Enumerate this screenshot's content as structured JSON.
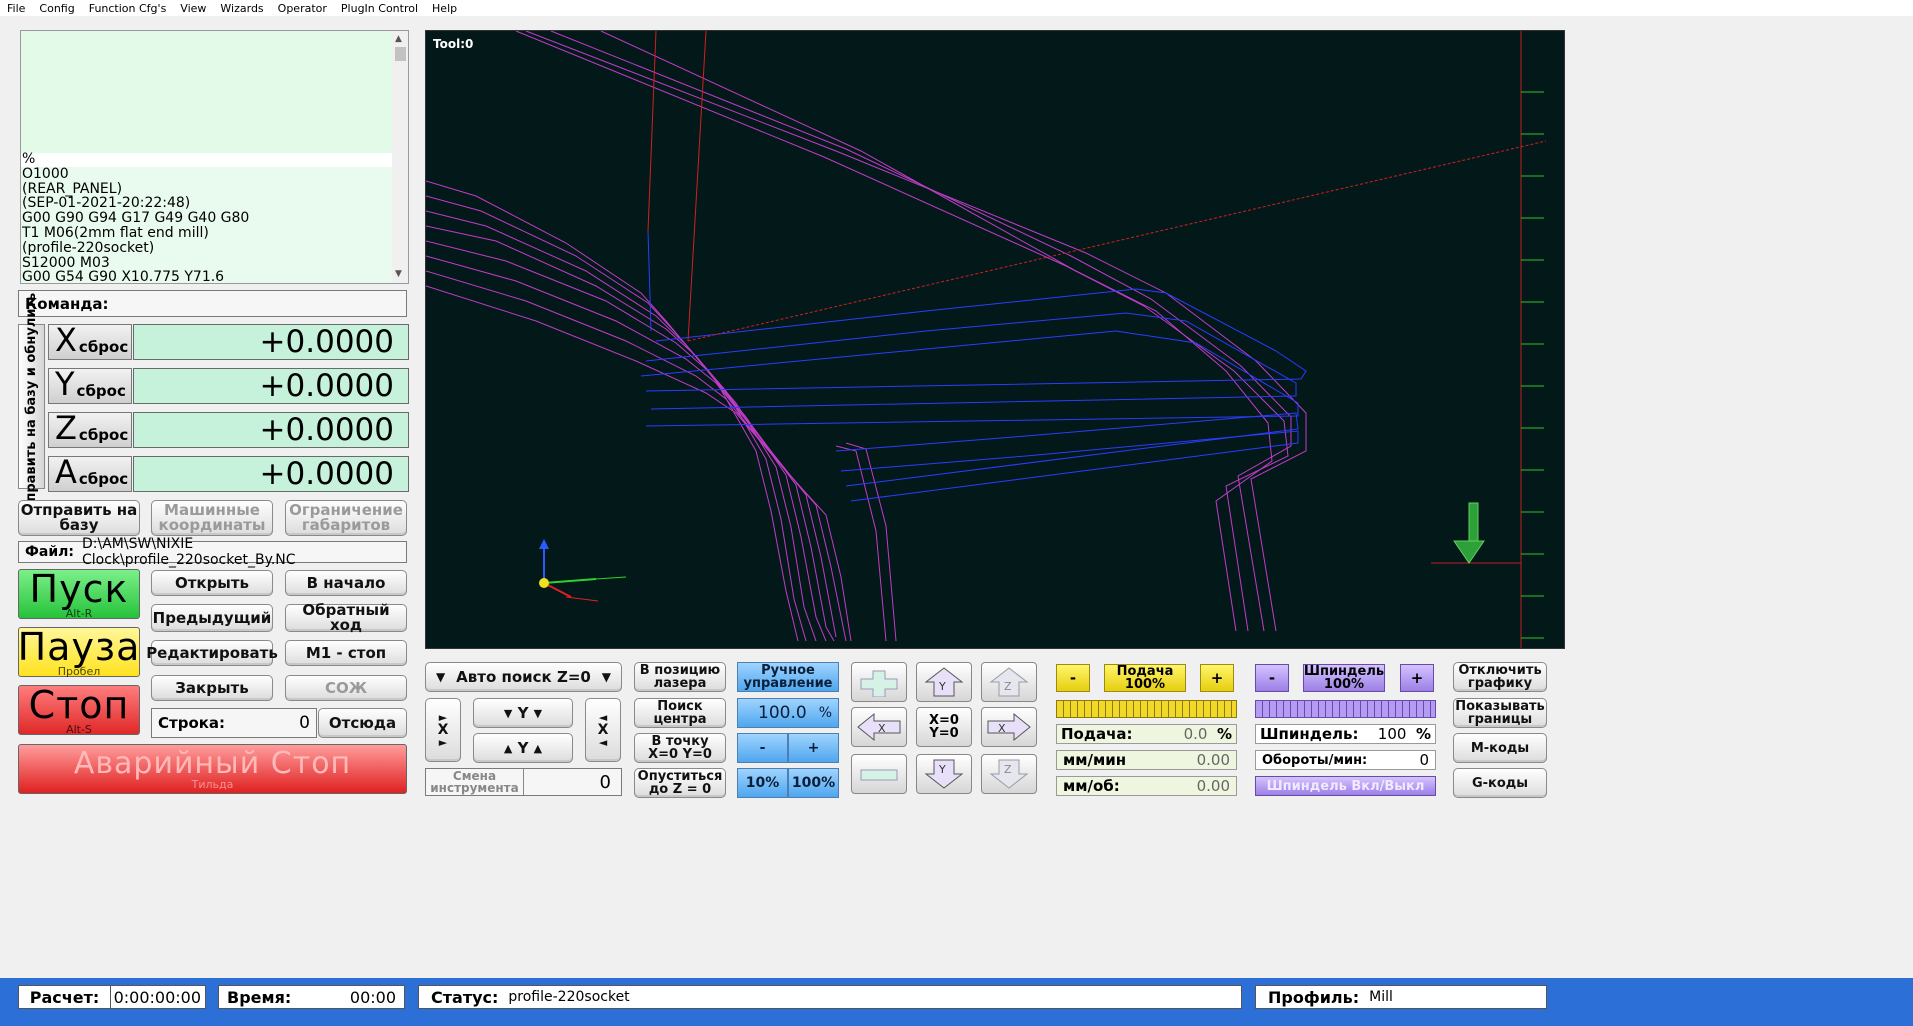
{
  "menu": [
    "File",
    "Config",
    "Function Cfg's",
    "View",
    "Wizards",
    "Operator",
    "PlugIn Control",
    "Help"
  ],
  "gcode_lines": [
    "%",
    "O1000",
    "(REAR_PANEL)",
    "(SEP-01-2021-20:22:48)",
    "G00 G90 G94 G17 G49 G40 G80",
    "T1 M06(2mm flat end mill)",
    "(profile-220socket)",
    "S12000 M03",
    "G00 G54 G90 X10.775 Y71.6"
  ],
  "command_label": "Команда:",
  "ref_all_label": "Отправить на базу и обнулить",
  "axes": [
    {
      "axis": "X",
      "reset": "сброс",
      "value": "+0.0000"
    },
    {
      "axis": "Y",
      "reset": "сброс",
      "value": "+0.0000"
    },
    {
      "axis": "Z",
      "reset": "сброс",
      "value": "+0.0000"
    },
    {
      "axis": "A",
      "reset": "сброс",
      "value": "+0.0000"
    }
  ],
  "buttons": {
    "ref_home": "Отправить на базу",
    "machine_coords": "Машинные координаты",
    "soft_limits": "Ограничение габаритов",
    "open": "Открыть",
    "rewind": "В начало",
    "prev": "Предыдущий",
    "reverse": "Обратный ход",
    "edit": "Редактировать",
    "m1": "М1 - стоп",
    "close": "Закрыть",
    "coolant": "СОЖ",
    "run_from": "Отсюда",
    "laser": "В позицию лазера",
    "manual": "Ручное управление",
    "find_center": "Поиск центра",
    "goto_zero": "В точку X=0 Y=0",
    "lower_z": "Опуститься до Z = 0",
    "tool_change": "Смена инструмента",
    "auto_z": "Авто поиск Z=0",
    "pct10": "10%",
    "pct100": "100%",
    "graphics_off": "Отключить графику",
    "show_bounds": "Показывать границы",
    "mcodes": "М-коды",
    "gcodes": "G-коды",
    "spindle_toggle": "Шпиндель Вкл/Выкл",
    "minus": "-",
    "plus": "+"
  },
  "file_label": "Файл:",
  "file_path": "D:\\AM\\SW\\NIXIE Clock\\profile_220socket_By.NC",
  "cycle": {
    "start": "Пуск",
    "start_key": "Alt-R",
    "pause": "Пауза",
    "pause_key": "Пробел",
    "stop": "Стоп",
    "stop_key": "Alt-S",
    "estop": "Аварийный Стоп",
    "estop_key": "Тильда"
  },
  "line_label": "Строка:",
  "line_value": "0",
  "jog_rate": "100.0",
  "jog_rate_unit": "%",
  "tool_value": "0",
  "viewport": {
    "tool_label": "Tool:0"
  },
  "jog": {
    "x": "X",
    "y": "Y",
    "xy_zero": "X=0\nY=0"
  },
  "feed": {
    "button": "Подача\n100%",
    "label": "Подача:",
    "value": "0.0",
    "unit": "%",
    "mmmin_label": "мм/мин",
    "mmmin_value": "0.00",
    "mmrev_label": "мм/об:",
    "mmrev_value": "0.00"
  },
  "spindle": {
    "button": "Шпиндель\n100%",
    "label": "Шпиндель:",
    "value": "100",
    "unit": "%",
    "rpm_label": "Обороты/мин:",
    "rpm_value": "0"
  },
  "status": {
    "calc_label": "Расчет:",
    "calc_value": "0:00:00:00",
    "time_label": "Время:",
    "time_value": "00:00",
    "status_label": "Статус:",
    "status_value": "profile-220socket",
    "profile_label": "Профиль:",
    "profile_value": "Mill"
  },
  "colors": {
    "dro_bg": "#c6f2dc",
    "viewport_bg": "#031818",
    "start": "#35d24e",
    "pause": "#ffe93a",
    "stop": "#e83a3a",
    "statusbar": "#2c6fd6",
    "toolpath": "#c13cc9",
    "toolpath_blue": "#2b3dff"
  }
}
